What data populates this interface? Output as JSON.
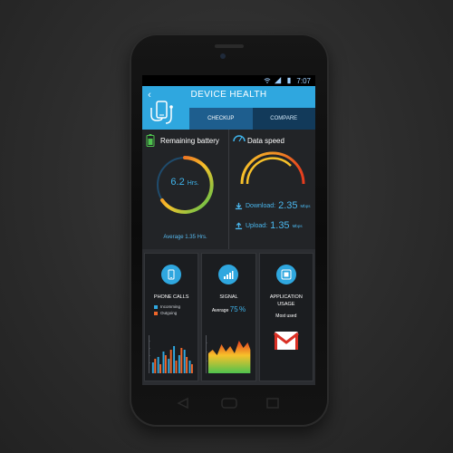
{
  "status_bar": {
    "time": "7:07"
  },
  "header": {
    "back_glyph": "‹",
    "title": "DEVICE HEALTH",
    "tabs": [
      {
        "label": "CHECKUP",
        "active": true
      },
      {
        "label": "COMPARE",
        "active": false
      }
    ]
  },
  "battery": {
    "title": "Remaining battery",
    "value": "6.2",
    "unit": "Hrs.",
    "average_label": "Average 1.35 Hrs."
  },
  "data_speed": {
    "title": "Data speed",
    "download": {
      "label": "Download:",
      "value": "2.35",
      "unit": "Mbps"
    },
    "upload": {
      "label": "Upload:",
      "value": "1.35",
      "unit": "Mbps"
    }
  },
  "cards": {
    "phone_calls": {
      "title": "PHONE CALLS",
      "legend": [
        {
          "label": "Incomming",
          "color": "#2fa7df"
        },
        {
          "label": "Outgoing",
          "color": "#f0662a"
        }
      ]
    },
    "signal": {
      "title": "SIGNAL",
      "average_label": "Average",
      "average_value": "75",
      "average_unit": "%"
    },
    "app_usage": {
      "title": "APPLICATION",
      "title2": "USAGE",
      "most_used_label": "Most used"
    }
  },
  "colors": {
    "accent": "#2fa7df",
    "dark_tab": "#123a5a",
    "background": "#2b2d31"
  },
  "icons": {
    "back": "chevron-left-icon",
    "header": "phone-stethoscope-icon",
    "battery": "battery-icon",
    "speed": "gauge-icon",
    "download": "download-icon",
    "upload": "upload-icon",
    "phone_calls": "phone-icon",
    "signal": "signal-bars-icon",
    "app": "app-square-icon",
    "gmail": "gmail-icon"
  }
}
